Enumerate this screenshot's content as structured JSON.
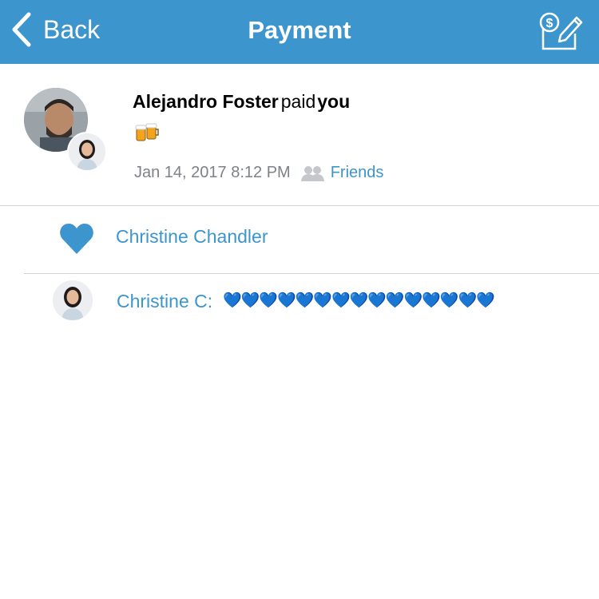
{
  "nav": {
    "back_label": "Back",
    "title": "Payment",
    "back_icon": "chevron-left-icon",
    "action_icon": "pay-request-icon"
  },
  "story": {
    "actor": "Alejandro Foster",
    "verb": "paid",
    "target": "you",
    "note": "🍻",
    "date": "Jan 14, 2017 8:12 PM",
    "audience": "Friends",
    "audience_icon": "friends-icon"
  },
  "likes": {
    "icon": "heart-icon",
    "names": "Christine Chandler"
  },
  "comments": [
    {
      "author": "Christine C:",
      "text": "💙💙💙💙💙💙💙💙💙💙💙💙💙💙💙"
    }
  ],
  "colors": {
    "brand_blue": "#3d95ce",
    "meta_gray": "#7e8287",
    "divider": "#cfd2d6"
  }
}
